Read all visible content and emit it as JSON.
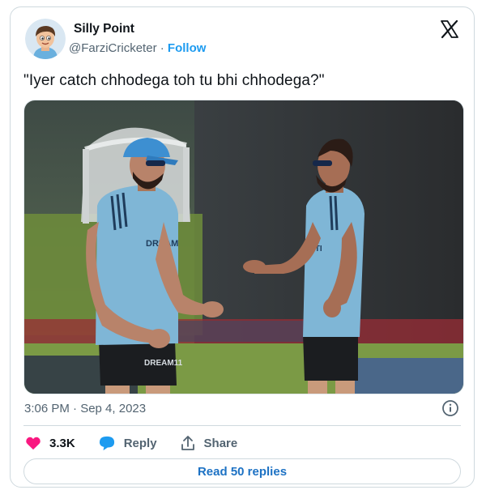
{
  "author": {
    "name": "Silly Point",
    "handle": "@FarziCricketer",
    "separator": " · ",
    "follow_label": "Follow"
  },
  "tweet": {
    "text": "\"Iyer catch chhodega toh tu bhi chhodega?\"",
    "timestamp": "3:06 PM · Sep 4, 2023"
  },
  "actions": {
    "likes": "3.3K",
    "reply_label": "Reply",
    "share_label": "Share"
  },
  "read_replies_label": "Read 50 replies",
  "photo": {
    "jersey_text_left": "DREAM11",
    "jersey_text_right": "DREAM11"
  },
  "colors": {
    "accent": "#1d9bf0",
    "heart": "#f91880",
    "reply_icon": "#1d9bf0",
    "jersey": "#7fb6d6"
  },
  "icons": [
    "x-logo-icon",
    "info-icon",
    "heart-icon",
    "reply-bubble-icon",
    "share-icon"
  ]
}
